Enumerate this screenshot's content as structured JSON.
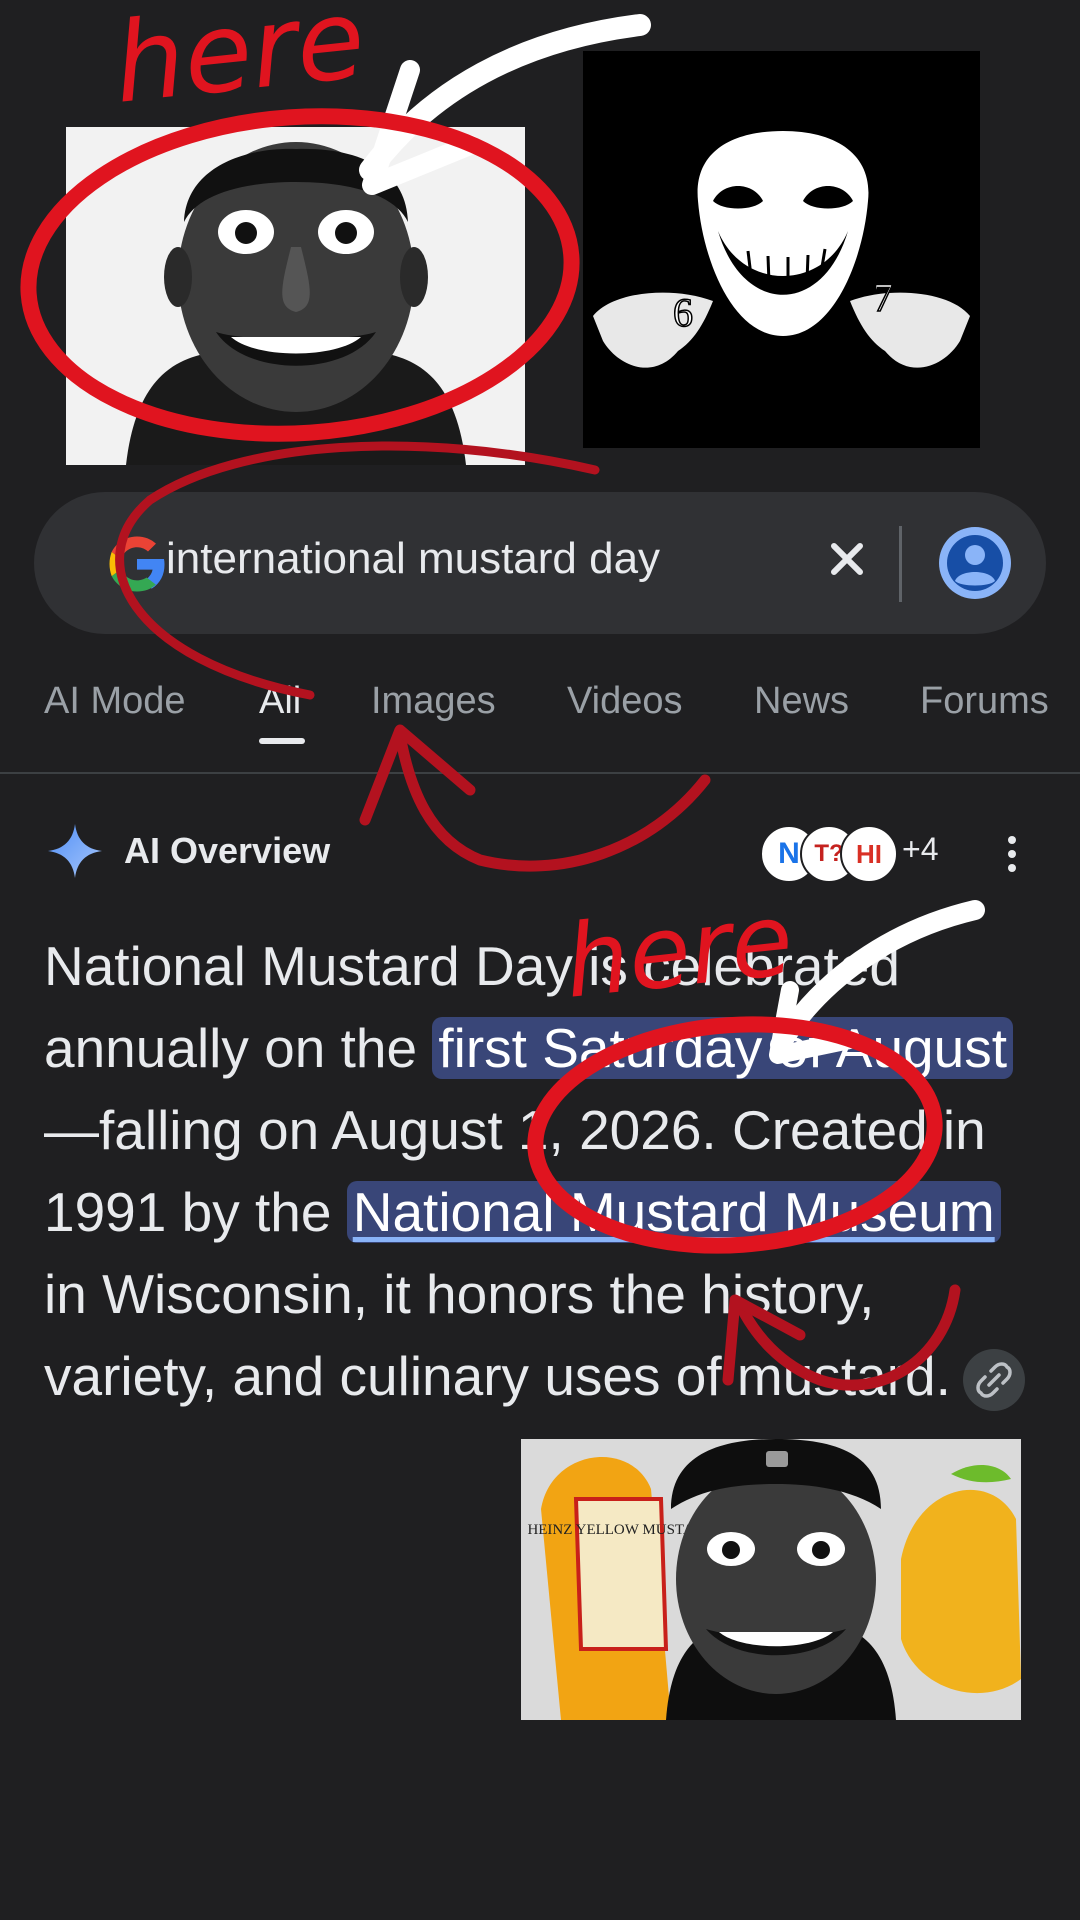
{
  "annotations": {
    "top_label": "here",
    "middle_label": "here"
  },
  "search": {
    "query": "international mustard day",
    "clear_icon": "close-icon",
    "account_icon": "account-circle-icon"
  },
  "tabs": [
    {
      "label": "AI Mode",
      "active": false
    },
    {
      "label": "All",
      "active": true
    },
    {
      "label": "Images",
      "active": false
    },
    {
      "label": "Videos",
      "active": false
    },
    {
      "label": "News",
      "active": false
    },
    {
      "label": "Forums",
      "active": false
    }
  ],
  "ai_overview": {
    "title": "AI Overview",
    "sources": [
      "N",
      "T?",
      "HI"
    ],
    "more_sources": "+4",
    "text": {
      "p1": "National Mustard Day is celebrated annually on the ",
      "h1": "first Saturday of August",
      "p2": "—falling on August 1, 2026. Created in 1991 by the ",
      "h2": "National Mustard Museum",
      "p3": " in Wisconsin, it honors the history, variety, and culinary uses of mustard."
    }
  },
  "images": {
    "mustard_bottle_label": "HEINZ YELLOW MUSTARD",
    "hand_numbers": [
      "6",
      "7"
    ]
  },
  "colors": {
    "background": "#1f1f21",
    "searchbar": "#303134",
    "highlight": "#394678",
    "annotation_red": "#e0141f",
    "arrow_white": "#ffffff"
  }
}
